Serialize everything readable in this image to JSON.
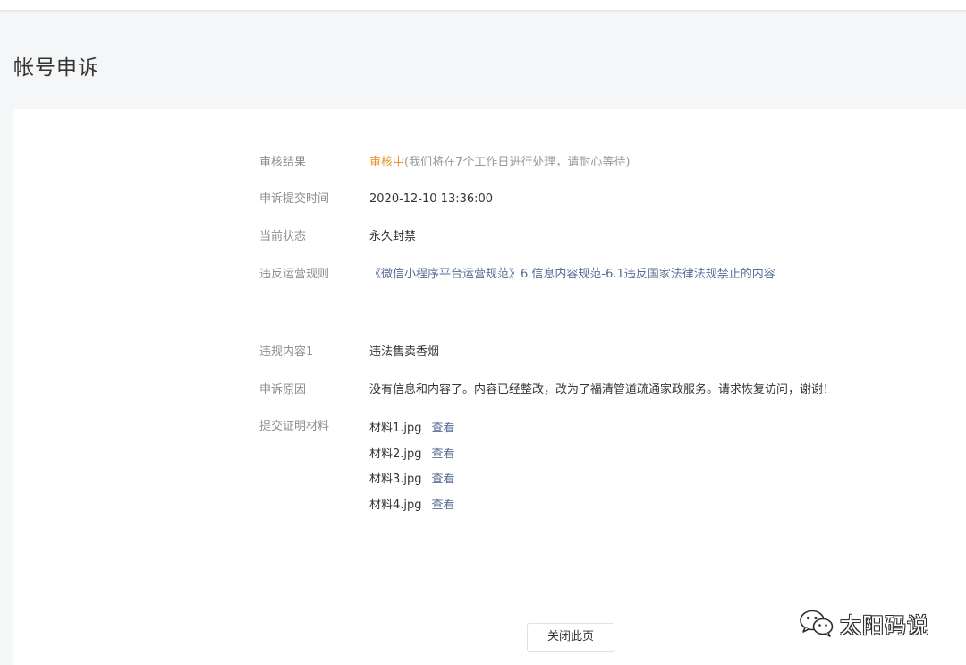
{
  "header": {
    "page_title": "帐号申诉"
  },
  "appeal": {
    "review_result": {
      "label": "审核结果",
      "status": "审核中",
      "note": "(我们将在7个工作日进行处理，请耐心等待)"
    },
    "submit_time": {
      "label": "申诉提交时间",
      "value": "2020-12-10 13:36:00"
    },
    "current_status": {
      "label": "当前状态",
      "value": "永久封禁"
    },
    "violated_rule": {
      "label": "违反运营规则",
      "value": "《微信小程序平台运营规范》6.信息内容规范-6.1违反国家法律法规禁止的内容"
    },
    "violation_content": {
      "label": "违规内容1",
      "value": "违法售卖香烟"
    },
    "appeal_reason": {
      "label": "申诉原因",
      "value": "没有信息和内容了。内容已经整改，改为了福清管道疏通家政服务。请求恢复访问，谢谢！"
    },
    "materials": {
      "label": "提交证明材料",
      "view_label": "查看",
      "files": [
        "材料1.jpg",
        "材料2.jpg",
        "材料3.jpg",
        "材料4.jpg"
      ]
    }
  },
  "footer": {
    "close_button": "关闭此页"
  },
  "watermark": {
    "text": "太阳码说",
    "icon": "wechat-icon"
  },
  "colors": {
    "status_orange": "#f0922d",
    "link_blue": "#576b95",
    "label_gray": "#8d8d8d"
  }
}
